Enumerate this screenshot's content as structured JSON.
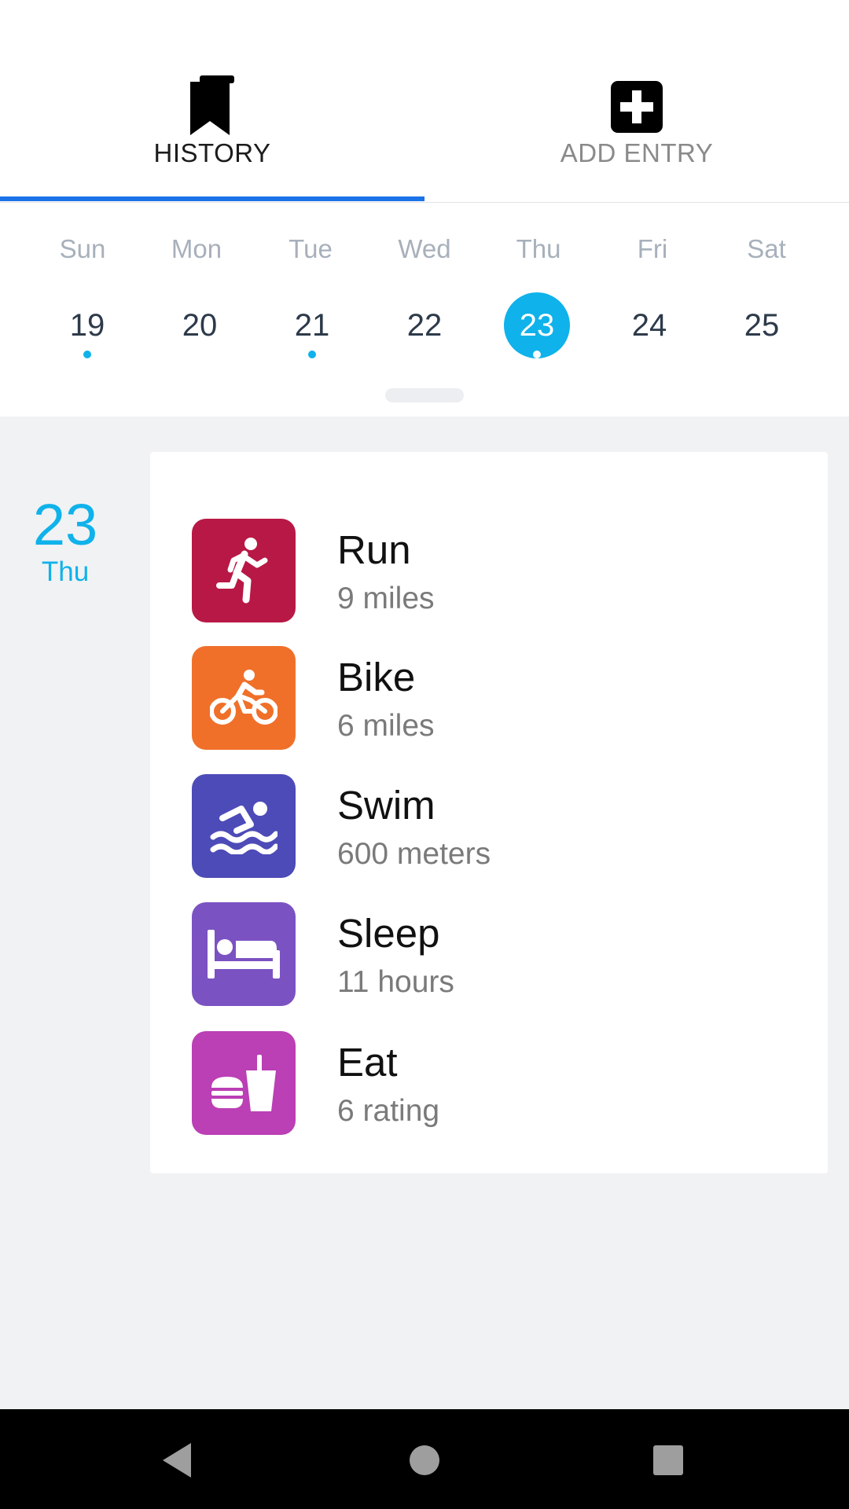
{
  "tabs": [
    {
      "label": "HISTORY",
      "icon": "bookmark-icon",
      "active": true
    },
    {
      "label": "ADD ENTRY",
      "icon": "plus-box-icon",
      "active": false
    }
  ],
  "calendar": {
    "weekdays": [
      "Sun",
      "Mon",
      "Tue",
      "Wed",
      "Thu",
      "Fri",
      "Sat"
    ],
    "dates": [
      {
        "day": "19",
        "has_entry": true,
        "selected": false
      },
      {
        "day": "20",
        "has_entry": false,
        "selected": false
      },
      {
        "day": "21",
        "has_entry": true,
        "selected": false
      },
      {
        "day": "22",
        "has_entry": false,
        "selected": false
      },
      {
        "day": "23",
        "has_entry": true,
        "selected": true
      },
      {
        "day": "24",
        "has_entry": false,
        "selected": false
      },
      {
        "day": "25",
        "has_entry": false,
        "selected": false
      }
    ]
  },
  "selected_day": {
    "number": "23",
    "weekday": "Thu"
  },
  "entries": [
    {
      "title": "Run",
      "value": "9 miles",
      "icon": "run-icon",
      "color": "#b81845"
    },
    {
      "title": "Bike",
      "value": "6 miles",
      "icon": "bike-icon",
      "color": "#f0702a"
    },
    {
      "title": "Swim",
      "value": "600 meters",
      "icon": "swim-icon",
      "color": "#4d4bb7"
    },
    {
      "title": "Sleep",
      "value": "11 hours",
      "icon": "bed-icon",
      "color": "#7b52c2"
    },
    {
      "title": "Eat",
      "value": "6 rating",
      "icon": "food-icon",
      "color": "#bb3fb5"
    }
  ],
  "colors": {
    "accent": "#0fb2ea",
    "tab_indicator": "#1b73e8",
    "background": "#f1f2f4"
  },
  "navbar": {
    "buttons": [
      "back-icon",
      "home-icon",
      "recents-icon"
    ]
  }
}
